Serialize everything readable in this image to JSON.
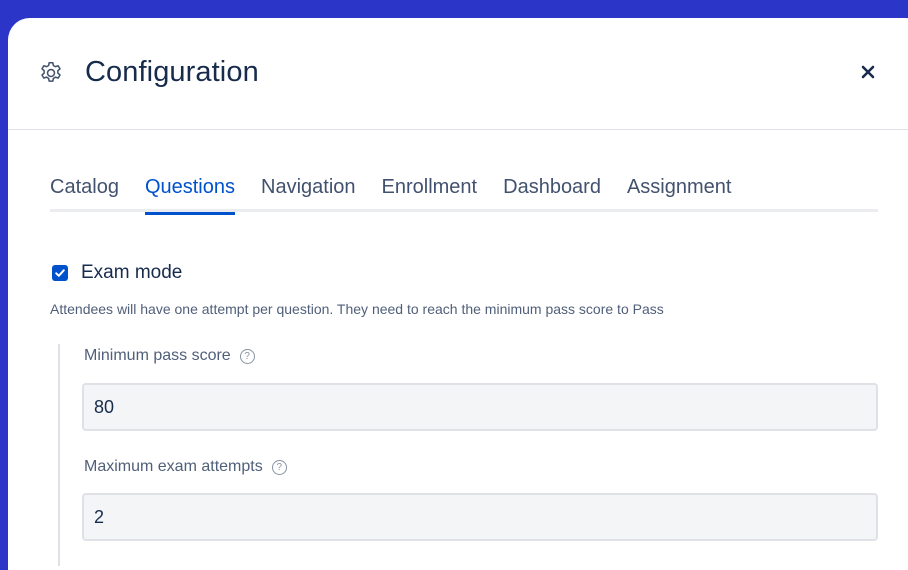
{
  "dialog": {
    "title": "Configuration",
    "title_icon": "gear-icon",
    "close_icon": "close-icon"
  },
  "tabs": [
    {
      "label": "Catalog",
      "active": false
    },
    {
      "label": "Questions",
      "active": true
    },
    {
      "label": "Navigation",
      "active": false
    },
    {
      "label": "Enrollment",
      "active": false
    },
    {
      "label": "Dashboard",
      "active": false
    },
    {
      "label": "Assignment",
      "active": false
    }
  ],
  "exam_mode": {
    "label": "Exam mode",
    "checked": true,
    "description": "Attendees will have one attempt per question. They need to reach the minimum pass score to Pass"
  },
  "fields": {
    "min_pass_score": {
      "label": "Minimum pass score",
      "value": "80",
      "help_icon": "help-icon"
    },
    "max_attempts": {
      "label": "Maximum exam attempts",
      "value": "2",
      "help_icon": "help-icon"
    }
  },
  "colors": {
    "background": "#2b36c9",
    "accent": "#0052cc",
    "text": "#172b4d"
  }
}
